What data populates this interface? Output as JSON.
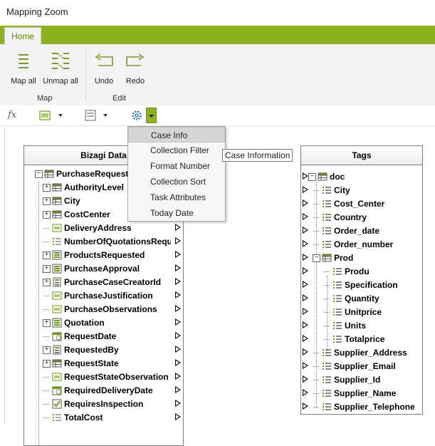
{
  "window": {
    "title": "Mapping Zoom"
  },
  "ribbon": {
    "tabs": [
      {
        "label": "Home"
      }
    ],
    "groups": [
      {
        "label": "Map",
        "buttons": [
          {
            "label": "Map all",
            "icon": "map-all-icon"
          },
          {
            "label": "Unmap all",
            "icon": "unmap-all-icon"
          }
        ]
      },
      {
        "label": "Edit",
        "buttons": [
          {
            "label": "Undo",
            "icon": "undo-icon"
          },
          {
            "label": "Redo",
            "icon": "redo-icon"
          }
        ]
      }
    ]
  },
  "toolbar": {
    "function_symbol": "fx",
    "function_icon": "function-icon",
    "text_tool_icon": "abc-text-icon",
    "text_function_icon": "text-function-icon",
    "settings_icon": "gear-icon"
  },
  "dropdown_menu": {
    "items": [
      "Case Info",
      "Collection Filter",
      "Format Number",
      "Collection Sort",
      "Task Attributes",
      "Today Date"
    ],
    "selected": "Case Info"
  },
  "tooltip": {
    "text": "Case Information"
  },
  "left_panel": {
    "title": "Bizagi Data",
    "items": [
      {
        "label": "PurchaseRequest",
        "icon": "table-icon",
        "expander": "−"
      },
      {
        "label": "AuthorityLevel",
        "icon": "table-icon",
        "expander": "+"
      },
      {
        "label": "City",
        "icon": "table-icon",
        "expander": "+"
      },
      {
        "label": "CostCenter",
        "icon": "table-icon",
        "expander": "+"
      },
      {
        "label": "DeliveryAddress",
        "icon": "text-field-icon",
        "expander": ""
      },
      {
        "label": "NumberOfQuotationsRequir",
        "icon": "number-field-icon",
        "expander": ""
      },
      {
        "label": "ProductsRequested",
        "icon": "collection-icon",
        "expander": "+"
      },
      {
        "label": "PurchaseApproval",
        "icon": "collection-icon",
        "expander": "+"
      },
      {
        "label": "PurchaseCaseCreatorId",
        "icon": "entity-icon",
        "expander": "+"
      },
      {
        "label": "PurchaseJustification",
        "icon": "text-field-icon",
        "expander": ""
      },
      {
        "label": "PurchaseObservations",
        "icon": "text-field-icon",
        "expander": ""
      },
      {
        "label": "Quotation",
        "icon": "collection-icon",
        "expander": "+"
      },
      {
        "label": "RequestDate",
        "icon": "date-icon",
        "expander": ""
      },
      {
        "label": "RequestedBy",
        "icon": "entity-icon",
        "expander": "+"
      },
      {
        "label": "RequestState",
        "icon": "table-icon",
        "expander": "+"
      },
      {
        "label": "RequestStateObservation",
        "icon": "text-field-icon",
        "expander": ""
      },
      {
        "label": "RequiredDeliveryDate",
        "icon": "date-icon",
        "expander": ""
      },
      {
        "label": "RequiresInspection",
        "icon": "checkbox-icon",
        "expander": ""
      },
      {
        "label": "TotalCost",
        "icon": "number-field-icon",
        "expander": ""
      }
    ]
  },
  "right_panel": {
    "title": "Tags",
    "items": [
      {
        "label": "doc",
        "icon": "table-icon",
        "expander": "−",
        "level": 0
      },
      {
        "label": "City",
        "icon": "element-icon",
        "expander": "",
        "level": 1
      },
      {
        "label": "Cost_Center",
        "icon": "element-icon",
        "expander": "",
        "level": 1
      },
      {
        "label": "Country",
        "icon": "element-icon",
        "expander": "",
        "level": 1
      },
      {
        "label": "Order_date",
        "icon": "element-icon",
        "expander": "",
        "level": 1
      },
      {
        "label": "Order_number",
        "icon": "element-icon",
        "expander": "",
        "level": 1
      },
      {
        "label": "Prod",
        "icon": "table-icon",
        "expander": "−",
        "level": 1
      },
      {
        "label": "Produ",
        "icon": "element-icon",
        "expander": "",
        "level": 2
      },
      {
        "label": "Specification",
        "icon": "element-icon",
        "expander": "",
        "level": 2
      },
      {
        "label": "Quantity",
        "icon": "element-icon",
        "expander": "",
        "level": 2
      },
      {
        "label": "Unitprice",
        "icon": "element-icon",
        "expander": "",
        "level": 2
      },
      {
        "label": "Units",
        "icon": "element-icon",
        "expander": "",
        "level": 2
      },
      {
        "label": "Totalprice",
        "icon": "element-icon",
        "expander": "",
        "level": 2
      },
      {
        "label": "Supplier_Address",
        "icon": "element-icon",
        "expander": "",
        "level": 1
      },
      {
        "label": "Supplier_Email",
        "icon": "element-icon",
        "expander": "",
        "level": 1
      },
      {
        "label": "Supplier_Id",
        "icon": "element-icon",
        "expander": "",
        "level": 1
      },
      {
        "label": "Supplier_Name",
        "icon": "element-icon",
        "expander": "",
        "level": 1
      },
      {
        "label": "Supplier_Telephone",
        "icon": "element-icon",
        "expander": "",
        "level": 1
      }
    ]
  },
  "colors": {
    "ribbon_green": "#8db11f",
    "icon_green": "#6e9b1a",
    "home_tab_text": "#5a8a00"
  }
}
